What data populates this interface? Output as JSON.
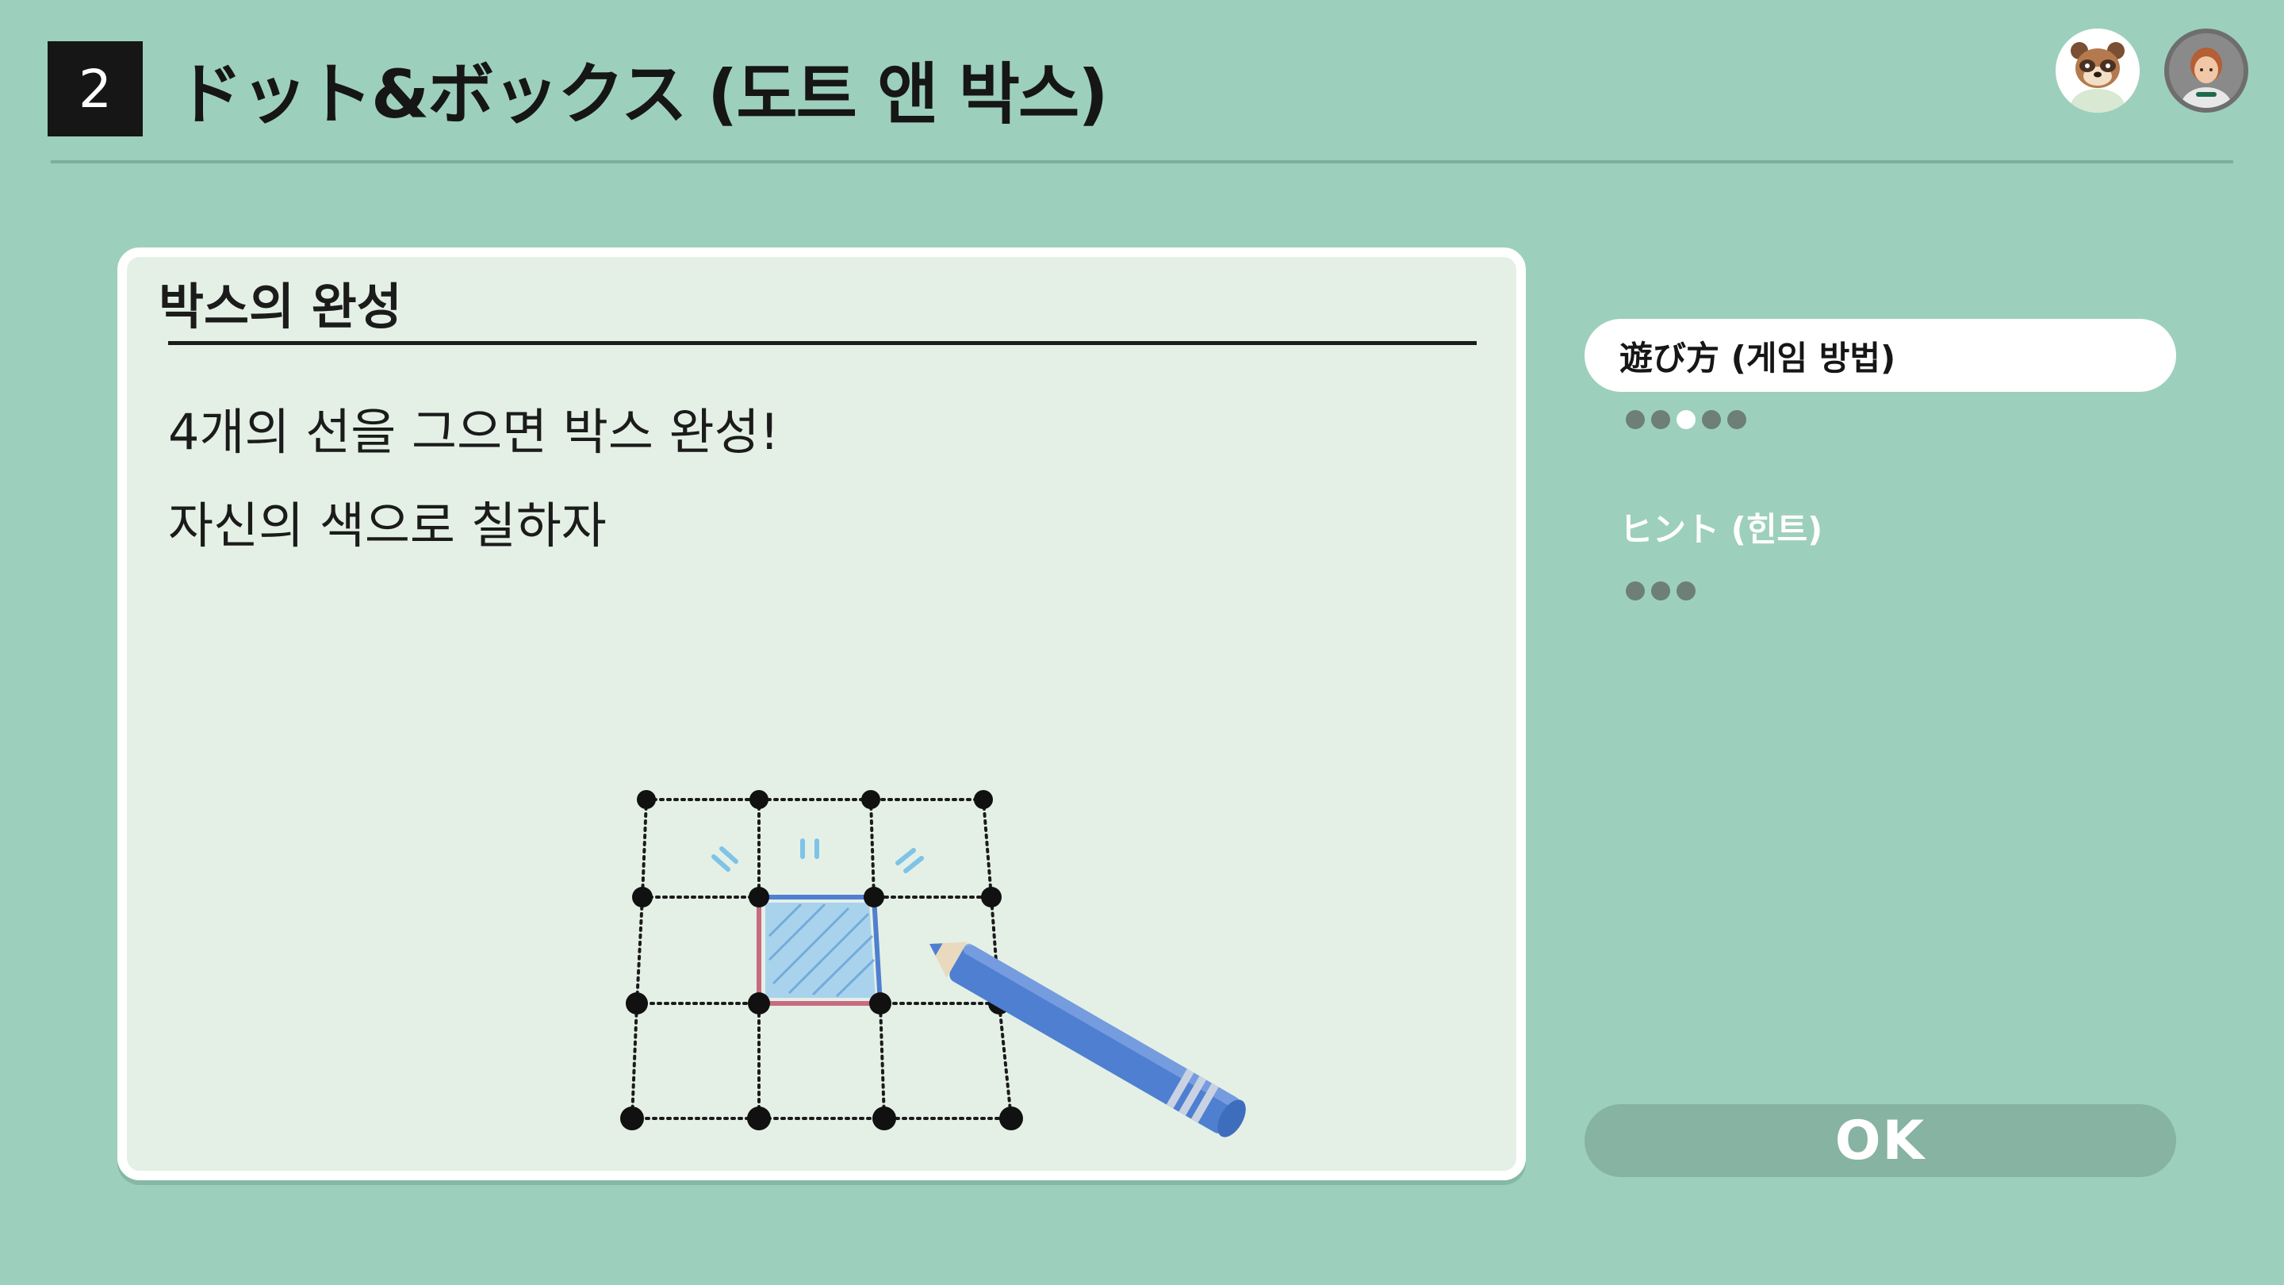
{
  "header": {
    "step_number": "2",
    "title": "ドット&ボックス (도트 앤 박스)"
  },
  "avatars": [
    {
      "icon": "raccoon-character-icon"
    },
    {
      "icon": "player-character-icon"
    }
  ],
  "card": {
    "heading": "박스의 완성",
    "lines": [
      "4개의 선을 그으면 박스 완성!",
      "자신의 색으로 칠하자"
    ]
  },
  "menu": {
    "items": [
      {
        "label": "遊び方 (게임 방법)",
        "page_count": 5,
        "current_page": 3
      },
      {
        "label": "ヒント (힌트)",
        "page_count": 3
      }
    ]
  },
  "ok_button": {
    "label": "OK"
  },
  "colors": {
    "background": "#9dcfbd",
    "card": "#e4f0e5",
    "blue_line": "#4f7fd0",
    "red_line": "#c86a82",
    "pencil": "#4f7fd0"
  }
}
